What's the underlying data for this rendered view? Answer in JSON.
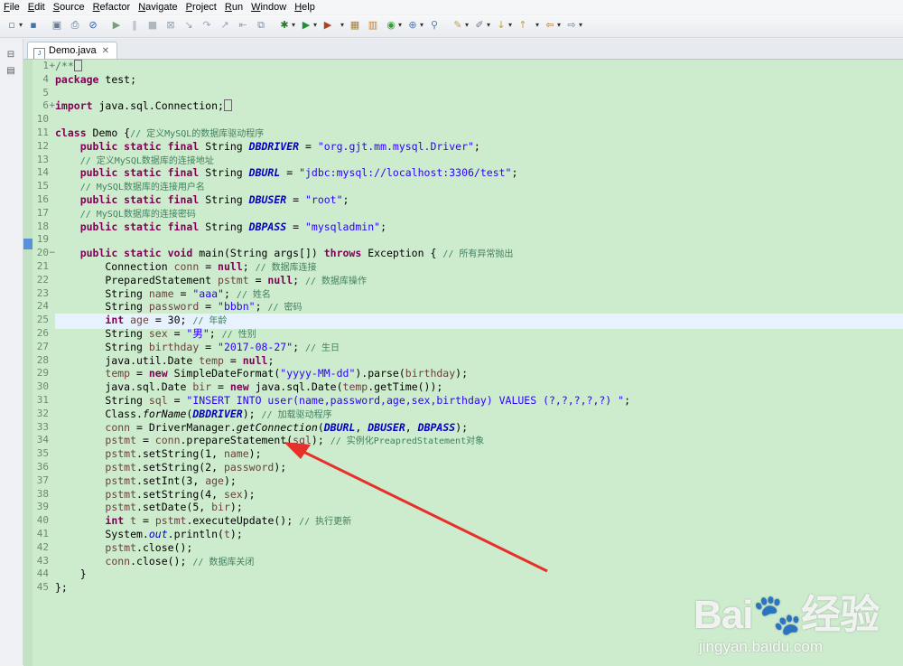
{
  "menu": [
    "File",
    "Edit",
    "Source",
    "Refactor",
    "Navigate",
    "Project",
    "Run",
    "Window",
    "Help"
  ],
  "toolbar_icons": [
    "new-icon",
    "save-icon",
    "save-all-icon",
    "print-icon",
    "skip-breakpoints-icon",
    "resume-icon",
    "suspend-icon",
    "terminate-icon",
    "disconnect-icon",
    "step-into-icon",
    "step-over-icon",
    "step-return-icon",
    "drop-to-frame-icon",
    "use-step-filters-icon",
    "debug-icon",
    "run-icon",
    "run-external-icon",
    "new-java-project-icon",
    "new-package-icon",
    "new-class-icon",
    "open-type-icon",
    "search-icon",
    "toggle-mark-occurrences-icon",
    "annotation-icon",
    "next-annotation-icon",
    "prev-annotation-icon",
    "back-icon",
    "forward-icon"
  ],
  "left_trim_icons": [
    "restore-icon",
    "package-explorer-icon"
  ],
  "editor": {
    "tab_label": "Demo.java",
    "tab_close": "✕"
  },
  "code_lines": [
    {
      "n": "1",
      "fold": "+",
      "html": "<span class=\"cm\" style=\"font-size:11.5px\">/**</span><span class=\"box\"></span>"
    },
    {
      "n": "4",
      "html": "<span class=\"kw\">package</span> test;"
    },
    {
      "n": "5",
      "html": ""
    },
    {
      "n": "6",
      "fold": "+",
      "html": "<span class=\"kw\">import</span> java.sql.Connection;<span class=\"box\"></span>"
    },
    {
      "n": "10",
      "html": ""
    },
    {
      "n": "11",
      "html": "<span class=\"kw\">class</span> Demo {<span class=\"cm\">// 定义MySQL的数据库驱动程序</span>"
    },
    {
      "n": "12",
      "html": "    <span class=\"kw\">public static final</span> String <span class=\"fd\">DBDRIVER</span> = <span class=\"st\">\"org.gjt.mm.mysql.Driver\"</span>;"
    },
    {
      "n": "13",
      "html": "    <span class=\"cm\">// 定义MySQL数据库的连接地址</span>"
    },
    {
      "n": "14",
      "html": "    <span class=\"kw\">public static final</span> String <span class=\"fd\">DBURL</span> = <span class=\"st\">\"jdbc:mysql://localhost:3306/test\"</span>;"
    },
    {
      "n": "15",
      "html": "    <span class=\"cm\">// MySQL数据库的连接用户名</span>"
    },
    {
      "n": "16",
      "html": "    <span class=\"kw\">public static final</span> String <span class=\"fd\">DBUSER</span> = <span class=\"st\">\"root\"</span>;"
    },
    {
      "n": "17",
      "html": "    <span class=\"cm\">// MySQL数据库的连接密码</span>"
    },
    {
      "n": "18",
      "html": "    <span class=\"kw\">public static final</span> String <span class=\"fd\">DBPASS</span> = <span class=\"st\">\"mysqladmin\"</span>;"
    },
    {
      "n": "19",
      "html": ""
    },
    {
      "n": "20",
      "fold": "−",
      "html": "    <span class=\"kw\">public static void</span> main(String args[]) <span class=\"kw\">throws</span> Exception { <span class=\"cm\">// 所有异常抛出</span>"
    },
    {
      "n": "21",
      "html": "        Connection <span class=\"va\">conn</span> = <span class=\"kw\">null</span>; <span class=\"cm\">// 数据库连接</span>"
    },
    {
      "n": "22",
      "html": "        PreparedStatement <span class=\"va\">pstmt</span> = <span class=\"kw\">null</span>; <span class=\"cm\">// 数据库操作</span>"
    },
    {
      "n": "23",
      "html": "        String <span class=\"va\">name</span> = <span class=\"st\">\"aaa\"</span>; <span class=\"cm\">// 姓名</span>"
    },
    {
      "n": "24",
      "html": "        String <span class=\"va\">password</span> = <span class=\"st\">\"bbbn\"</span>; <span class=\"cm\">// 密码</span>"
    },
    {
      "n": "25",
      "hl": true,
      "html": "        <span class=\"kw\">int</span> <span class=\"va\">age</span> = 30; <span class=\"cm\">// 年龄</span>"
    },
    {
      "n": "26",
      "html": "        String <span class=\"va\">sex</span> = <span class=\"st\">\"男\"</span>; <span class=\"cm\">// 性别</span>"
    },
    {
      "n": "27",
      "html": "        String <span class=\"va\">birthday</span> = <span class=\"st\">\"2017-08-27\"</span>; <span class=\"cm\">// 生日</span>"
    },
    {
      "n": "28",
      "html": "        java.util.Date <span class=\"va\">temp</span> = <span class=\"kw\">null</span>;"
    },
    {
      "n": "29",
      "html": "        <span class=\"va\">temp</span> = <span class=\"kw\">new</span> SimpleDateFormat(<span class=\"st\">\"yyyy-MM-dd\"</span>).parse(<span class=\"va\">birthday</span>);"
    },
    {
      "n": "30",
      "html": "        java.sql.Date <span class=\"va\">bir</span> = <span class=\"kw\">new</span> java.sql.Date(<span class=\"va\">temp</span>.getTime());"
    },
    {
      "n": "31",
      "html": "        String <span class=\"va\">sql</span> = <span class=\"st\">\"INSERT INTO user(name,password,age,sex,birthday) VALUES (?,?,?,?,?) \"</span>;"
    },
    {
      "n": "32",
      "html": "        Class.<span class=\"mi\">forName</span>(<span class=\"fd\">DBDRIVER</span>); <span class=\"cm\">// 加载驱动程序</span>"
    },
    {
      "n": "33",
      "html": "        <span class=\"va\">conn</span> = DriverManager.<span class=\"mi\">getConnection</span>(<span class=\"fd\">DBURL</span>, <span class=\"fd\">DBUSER</span>, <span class=\"fd\">DBPASS</span>);"
    },
    {
      "n": "34",
      "html": "        <span class=\"va\">pstmt</span> = <span class=\"va\">conn</span>.prepareStatement(<span class=\"va\">sql</span>); <span class=\"cm\">// 实例化PreapredStatement对象</span>"
    },
    {
      "n": "35",
      "html": "        <span class=\"va\">pstmt</span>.setString(1, <span class=\"va\">name</span>);"
    },
    {
      "n": "36",
      "html": "        <span class=\"va\">pstmt</span>.setString(2, <span class=\"va\">password</span>);"
    },
    {
      "n": "37",
      "html": "        <span class=\"va\">pstmt</span>.setInt(3, <span class=\"va\">age</span>);"
    },
    {
      "n": "38",
      "html": "        <span class=\"va\">pstmt</span>.setString(4, <span class=\"va\">sex</span>);"
    },
    {
      "n": "39",
      "html": "        <span class=\"va\">pstmt</span>.setDate(5, <span class=\"va\">bir</span>);"
    },
    {
      "n": "40",
      "html": "        <span class=\"kw\">int</span> <span class=\"va\">t</span> = <span class=\"va\">pstmt</span>.executeUpdate(); <span class=\"cm\">// 执行更新</span>"
    },
    {
      "n": "41",
      "html": "        System.<span class=\"fi\">out</span>.println(<span class=\"va\">t</span>);"
    },
    {
      "n": "42",
      "html": "        <span class=\"va\">pstmt</span>.close();"
    },
    {
      "n": "43",
      "html": "        <span class=\"va\">conn</span>.close(); <span class=\"cm\">// 数据库关闭</span>"
    },
    {
      "n": "44",
      "html": "    }"
    },
    {
      "n": "45",
      "html": "};"
    }
  ],
  "watermark": {
    "brand": "Bai🐾经验",
    "url": "jingyan.baidu.com"
  },
  "colors": {
    "editor_bg": "#cdeccd",
    "current_line": "#e8f2fe",
    "keyword": "#7f0055",
    "string": "#2a00ff",
    "comment": "#3f7f5f",
    "constant": "#0000c0",
    "arrow": "#e8302a"
  }
}
